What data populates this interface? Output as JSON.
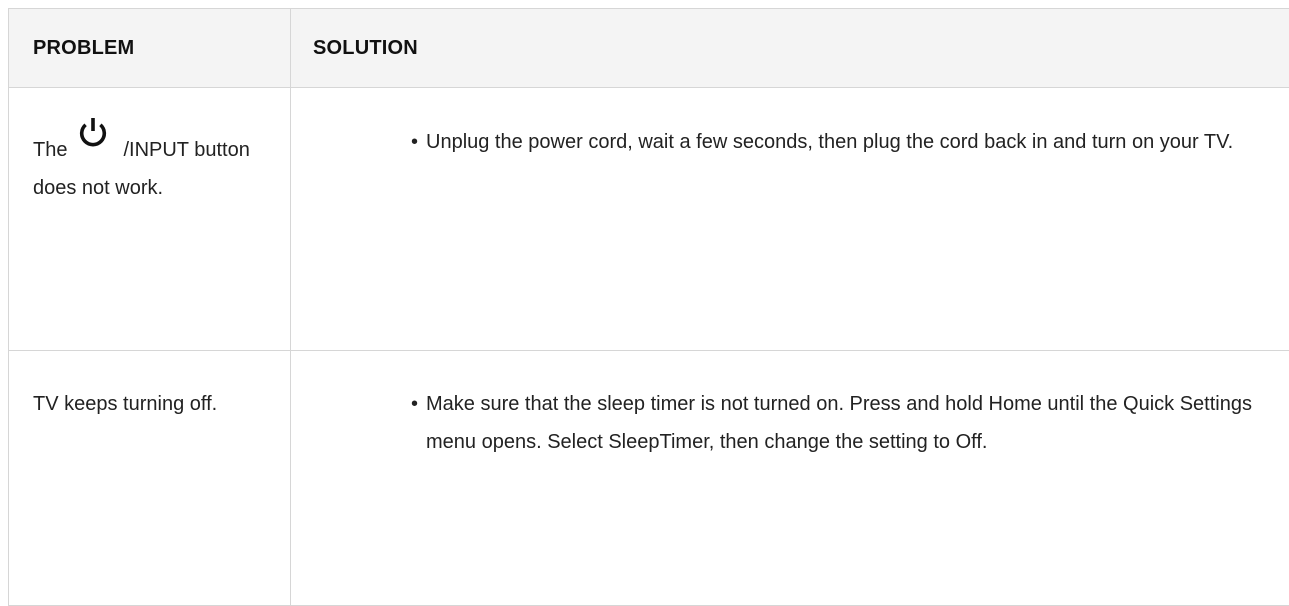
{
  "table": {
    "headers": {
      "problem": "PROBLEM",
      "solution": "SOLUTION"
    },
    "rows": [
      {
        "problem_prefix": "The",
        "problem_icon": "power-icon",
        "problem_suffix": "/INPUT button does not work.",
        "solutions": [
          "Unplug the power cord, wait a few seconds, then plug the cord back in and turn on your TV."
        ]
      },
      {
        "problem": "TV keeps turning off.",
        "solutions": [
          "Make sure that the sleep timer is not turned on. Press and hold Home until the Quick Settings menu opens. Select SleepTimer, then change the setting to Off."
        ]
      }
    ],
    "bullet": "•"
  },
  "colors": {
    "border": "#d6d6d6",
    "header_bg": "#f4f4f4",
    "text": "#222222"
  }
}
